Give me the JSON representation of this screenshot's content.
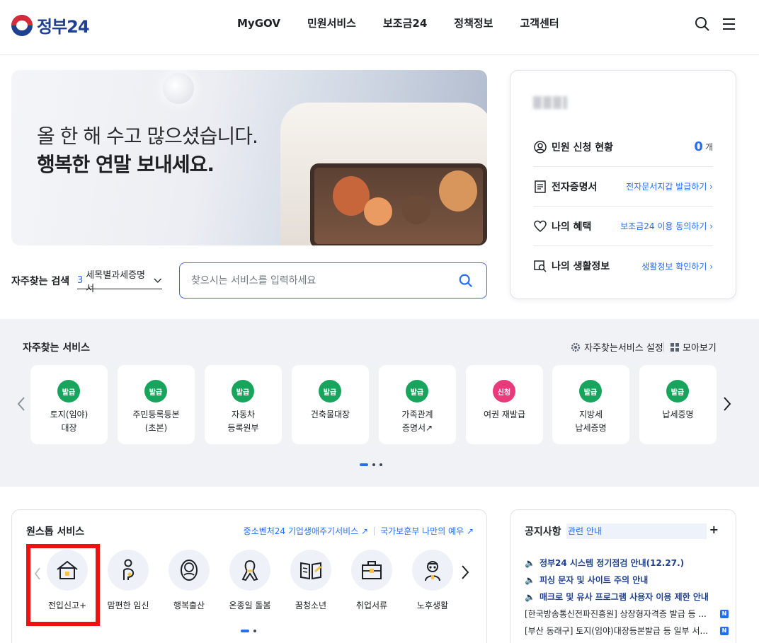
{
  "header": {
    "logo_text": "정부24",
    "nav": [
      "MyGOV",
      "민원서비스",
      "보조금24",
      "정책정보",
      "고객센터"
    ],
    "icons": [
      "search-icon",
      "menu-icon"
    ]
  },
  "banner": {
    "line1": "올 한 해 수고 많으셨습니다.",
    "line2": "행복한 연말 보내세요."
  },
  "frequent_search": {
    "label": "자주찾는 검색",
    "rank": "3",
    "keyword": "세목별과세증명서",
    "placeholder": "찾으시는 서비스를 입력하세요"
  },
  "user_panel": {
    "rows": [
      {
        "title": "민원 신청 현황",
        "count": "0",
        "unit": "개"
      },
      {
        "title": "전자증명서",
        "link": "전자문서지갑 발급하기 ›"
      },
      {
        "title": "나의 혜택",
        "link": "보조금24 이용 동의하기 ›"
      },
      {
        "title": "나의 생활정보",
        "link": "생활정보 확인하기 ›"
      }
    ]
  },
  "services": {
    "title": "자주찾는 서비스",
    "settings_label": "자주찾는서비스 설정",
    "all_label": "모아보기",
    "items": [
      {
        "badge": "발급",
        "name": "토지(임야)\n대장"
      },
      {
        "badge": "발급",
        "name": "주민등록등본\n(초본)"
      },
      {
        "badge": "발급",
        "name": "자동차\n등록원부"
      },
      {
        "badge": "발급",
        "name": "건축물대장"
      },
      {
        "badge": "발급",
        "name": "가족관계\n증명서↗"
      },
      {
        "badge": "신청",
        "name": "여권 재발급"
      },
      {
        "badge": "발급",
        "name": "지방세\n납세증명"
      },
      {
        "badge": "발급",
        "name": "납세증명"
      }
    ]
  },
  "onestop": {
    "title": "원스톱 서비스",
    "link1": "중소벤처24 기업생애주기서비스 ↗",
    "link2": "국가보훈부 나만의 예우 ↗",
    "items": [
      "전입신고+",
      "맘편한 임신",
      "행복출산",
      "온종일 돌봄",
      "꿈청소년",
      "취업서류",
      "노후생활"
    ]
  },
  "notice": {
    "title": "공지사항",
    "ticker": "관련 안내",
    "plus": "+",
    "items": [
      {
        "text": "정부24 시스템 정기점검 안내(12.27.)",
        "strong": true
      },
      {
        "text": "피싱 문자 및 사이트 주의 안내",
        "strong": true
      },
      {
        "text": "매크로 및 유사 프로그램 사용자 이용 제한 안내",
        "strong": true
      },
      {
        "text": "[한국방송통신전파진흥원] 상장형자격증 발급 등 ...",
        "new": "N"
      },
      {
        "text": "[부산 동래구] 토지(임야)대장등본발급 등 일부 서...",
        "new": "N"
      }
    ]
  }
}
